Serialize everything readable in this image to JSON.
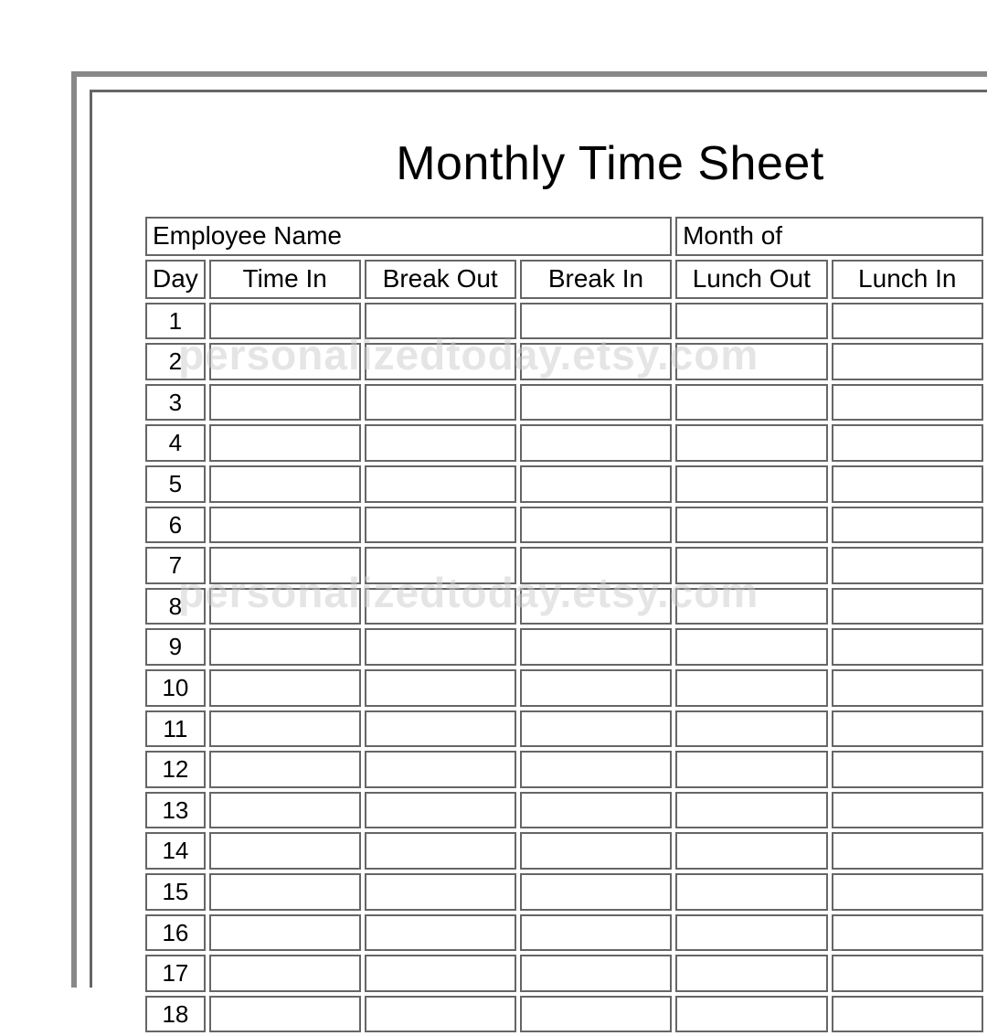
{
  "title": "Monthly Time Sheet",
  "info": {
    "employee_label": "Employee Name",
    "month_label": "Month of"
  },
  "headers": {
    "day": "Day",
    "time_in": "Time In",
    "break_out": "Break Out",
    "break_in": "Break In",
    "lunch_out": "Lunch Out",
    "lunch_in": "Lunch In"
  },
  "rows": [
    {
      "day": "1"
    },
    {
      "day": "2"
    },
    {
      "day": "3"
    },
    {
      "day": "4"
    },
    {
      "day": "5"
    },
    {
      "day": "6"
    },
    {
      "day": "7"
    },
    {
      "day": "8"
    },
    {
      "day": "9"
    },
    {
      "day": "10"
    },
    {
      "day": "11"
    },
    {
      "day": "12"
    },
    {
      "day": "13"
    },
    {
      "day": "14"
    },
    {
      "day": "15"
    },
    {
      "day": "16"
    },
    {
      "day": "17"
    },
    {
      "day": "18"
    }
  ],
  "watermark": "personalizedtoday.etsy.com"
}
